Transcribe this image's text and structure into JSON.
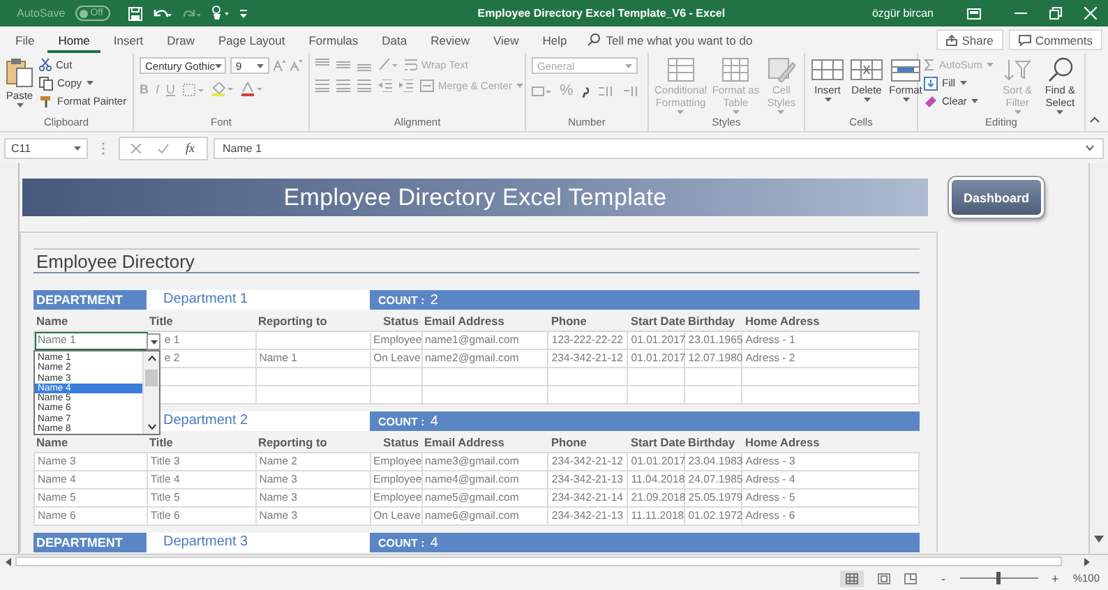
{
  "title_bar": {
    "autosave_label": "AutoSave",
    "autosave_state": "Off",
    "autosave_on": false,
    "title": "Employee Directory Excel Template_V6  -  Excel",
    "user": "özgür bircan"
  },
  "tabs": [
    {
      "label": "File",
      "selected": false
    },
    {
      "label": "Home",
      "selected": true
    },
    {
      "label": "Insert",
      "selected": false
    },
    {
      "label": "Draw",
      "selected": false
    },
    {
      "label": "Page Layout",
      "selected": false
    },
    {
      "label": "Formulas",
      "selected": false
    },
    {
      "label": "Data",
      "selected": false
    },
    {
      "label": "Review",
      "selected": false
    },
    {
      "label": "View",
      "selected": false
    },
    {
      "label": "Help",
      "selected": false
    }
  ],
  "tell_me": {
    "placeholder": "Tell me what you want to do"
  },
  "share": "Share",
  "comments": "Comments",
  "ribbon": [
    {
      "kind": "clipboard",
      "label": "Clipboard",
      "items": [
        {
          "label": "Paste",
          "disabled": false
        },
        {
          "label": "Cut",
          "disabled": false
        },
        {
          "label": "Copy",
          "disabled": false
        },
        {
          "label": "Format Painter",
          "disabled": false
        }
      ]
    },
    {
      "kind": "font",
      "label": "Font",
      "font": "Century Gothic",
      "size": "9",
      "items": [
        {
          "label": "B",
          "disabled": true
        },
        {
          "label": "I",
          "disabled": true
        },
        {
          "label": "U",
          "disabled": true
        }
      ]
    },
    {
      "kind": "alignment",
      "label": "Alignment",
      "items": [
        {
          "label": "Wrap Text",
          "disabled": true
        },
        {
          "label": "Merge & Center",
          "disabled": true
        }
      ]
    },
    {
      "kind": "number",
      "label": "Number",
      "format": "General",
      "items": [
        {
          "label": "%",
          "disabled": true
        }
      ]
    },
    {
      "kind": "styles",
      "label": "Styles",
      "items": [
        {
          "label": "Conditional Formatting",
          "disabled": true
        },
        {
          "label": "Format as Table",
          "disabled": true
        },
        {
          "label": "Cell Styles",
          "disabled": true
        }
      ]
    },
    {
      "kind": "cells",
      "label": "Cells",
      "items": [
        {
          "label": "Insert",
          "disabled": false
        },
        {
          "label": "Delete",
          "disabled": false
        },
        {
          "label": "Format",
          "disabled": false
        }
      ]
    },
    {
      "kind": "editing",
      "label": "Editing",
      "items": [
        {
          "label": "AutoSum",
          "disabled": true
        },
        {
          "label": "Fill",
          "disabled": false
        },
        {
          "label": "Clear",
          "disabled": false
        },
        {
          "label": "Sort & Filter",
          "disabled": true
        },
        {
          "label": "Find & Select",
          "disabled": false
        }
      ]
    }
  ],
  "formula_bar": {
    "cell": "C11",
    "function_button": "fx",
    "value": "Name 1"
  },
  "sheet": {
    "banner": "Employee Directory Excel Template",
    "dashboard": "Dashboard",
    "heading": "Employee Directory",
    "departments": [
      {
        "label": "DEPARTMENT",
        "name": "Department 1",
        "count_label": "COUNT :",
        "count": "2",
        "columns": [
          "Name",
          "Title",
          "Reporting to",
          "Status",
          "Email Address",
          "Phone",
          "Start Date",
          "Birthday",
          "Home Adress"
        ],
        "rows": [
          {
            "blank": false,
            "active": true,
            "cells": [
              "Name 1",
              "e 1",
              null,
              "Employee",
              "name1@gmail.com",
              "123-222-22-22",
              "01.01.2017",
              "23.01.1965",
              "Adress - 1"
            ]
          },
          {
            "blank": false,
            "cells": [
              null,
              "e 2",
              "Name 1",
              "On Leave",
              "name2@gmail.com",
              "234-342-21-12",
              "01.01.2017",
              "12.07.1980",
              "Adress - 2"
            ]
          },
          {
            "blank": true
          },
          {
            "blank": true
          }
        ],
        "dropdown": {
          "items": [
            {
              "label": "Name 1",
              "selected": false
            },
            {
              "label": "Name 2",
              "selected": false
            },
            {
              "label": "Name 3",
              "selected": false
            },
            {
              "label": "Name 4",
              "selected": true
            },
            {
              "label": "Name 5",
              "selected": false
            },
            {
              "label": "Name 6",
              "selected": false
            },
            {
              "label": "Name 7",
              "selected": false
            },
            {
              "label": "Name 8",
              "selected": false
            }
          ]
        }
      },
      {
        "name": "Department 2",
        "count_label": "COUNT :",
        "count": "4",
        "columns": [
          "Name",
          "Title",
          "Reporting to",
          "Status",
          "Email Address",
          "Phone",
          "Start Date",
          "Birthday",
          "Home Adress"
        ],
        "rows": [
          {
            "blank": false,
            "active": false,
            "cells": [
              "Name 3",
              "Title 3",
              "Name 2",
              "Employee",
              "name3@gmail.com",
              "234-342-21-12",
              "01.01.2017",
              "23.04.1983",
              "Adress - 3"
            ]
          },
          {
            "blank": false,
            "active": false,
            "cells": [
              "Name 4",
              "Title 4",
              "Name 3",
              "Employee",
              "name4@gmail.com",
              "234-342-21-13",
              "11.04.2018",
              "24.07.1985",
              "Adress - 4"
            ]
          },
          {
            "blank": false,
            "active": false,
            "cells": [
              "Name 5",
              "Title 5",
              "Name 3",
              "Employee",
              "name5@gmail.com",
              "234-342-21-14",
              "21.09.2018",
              "25.05.1979",
              "Adress - 5"
            ]
          },
          {
            "blank": false,
            "active": false,
            "cells": [
              "Name 6",
              "Title 6",
              "Name 3",
              "On Leave",
              "name6@gmail.com",
              "234-342-21-13",
              "11.11.2018",
              "01.02.1972",
              "Adress - 6"
            ]
          }
        ]
      },
      {
        "label": "DEPARTMENT",
        "name": "Department 3",
        "count_label": "COUNT :",
        "count": "4"
      }
    ]
  },
  "status_bar": {
    "zoom_out": "-",
    "zoom_in": "+",
    "zoom": "%100",
    "level": 0.5
  }
}
